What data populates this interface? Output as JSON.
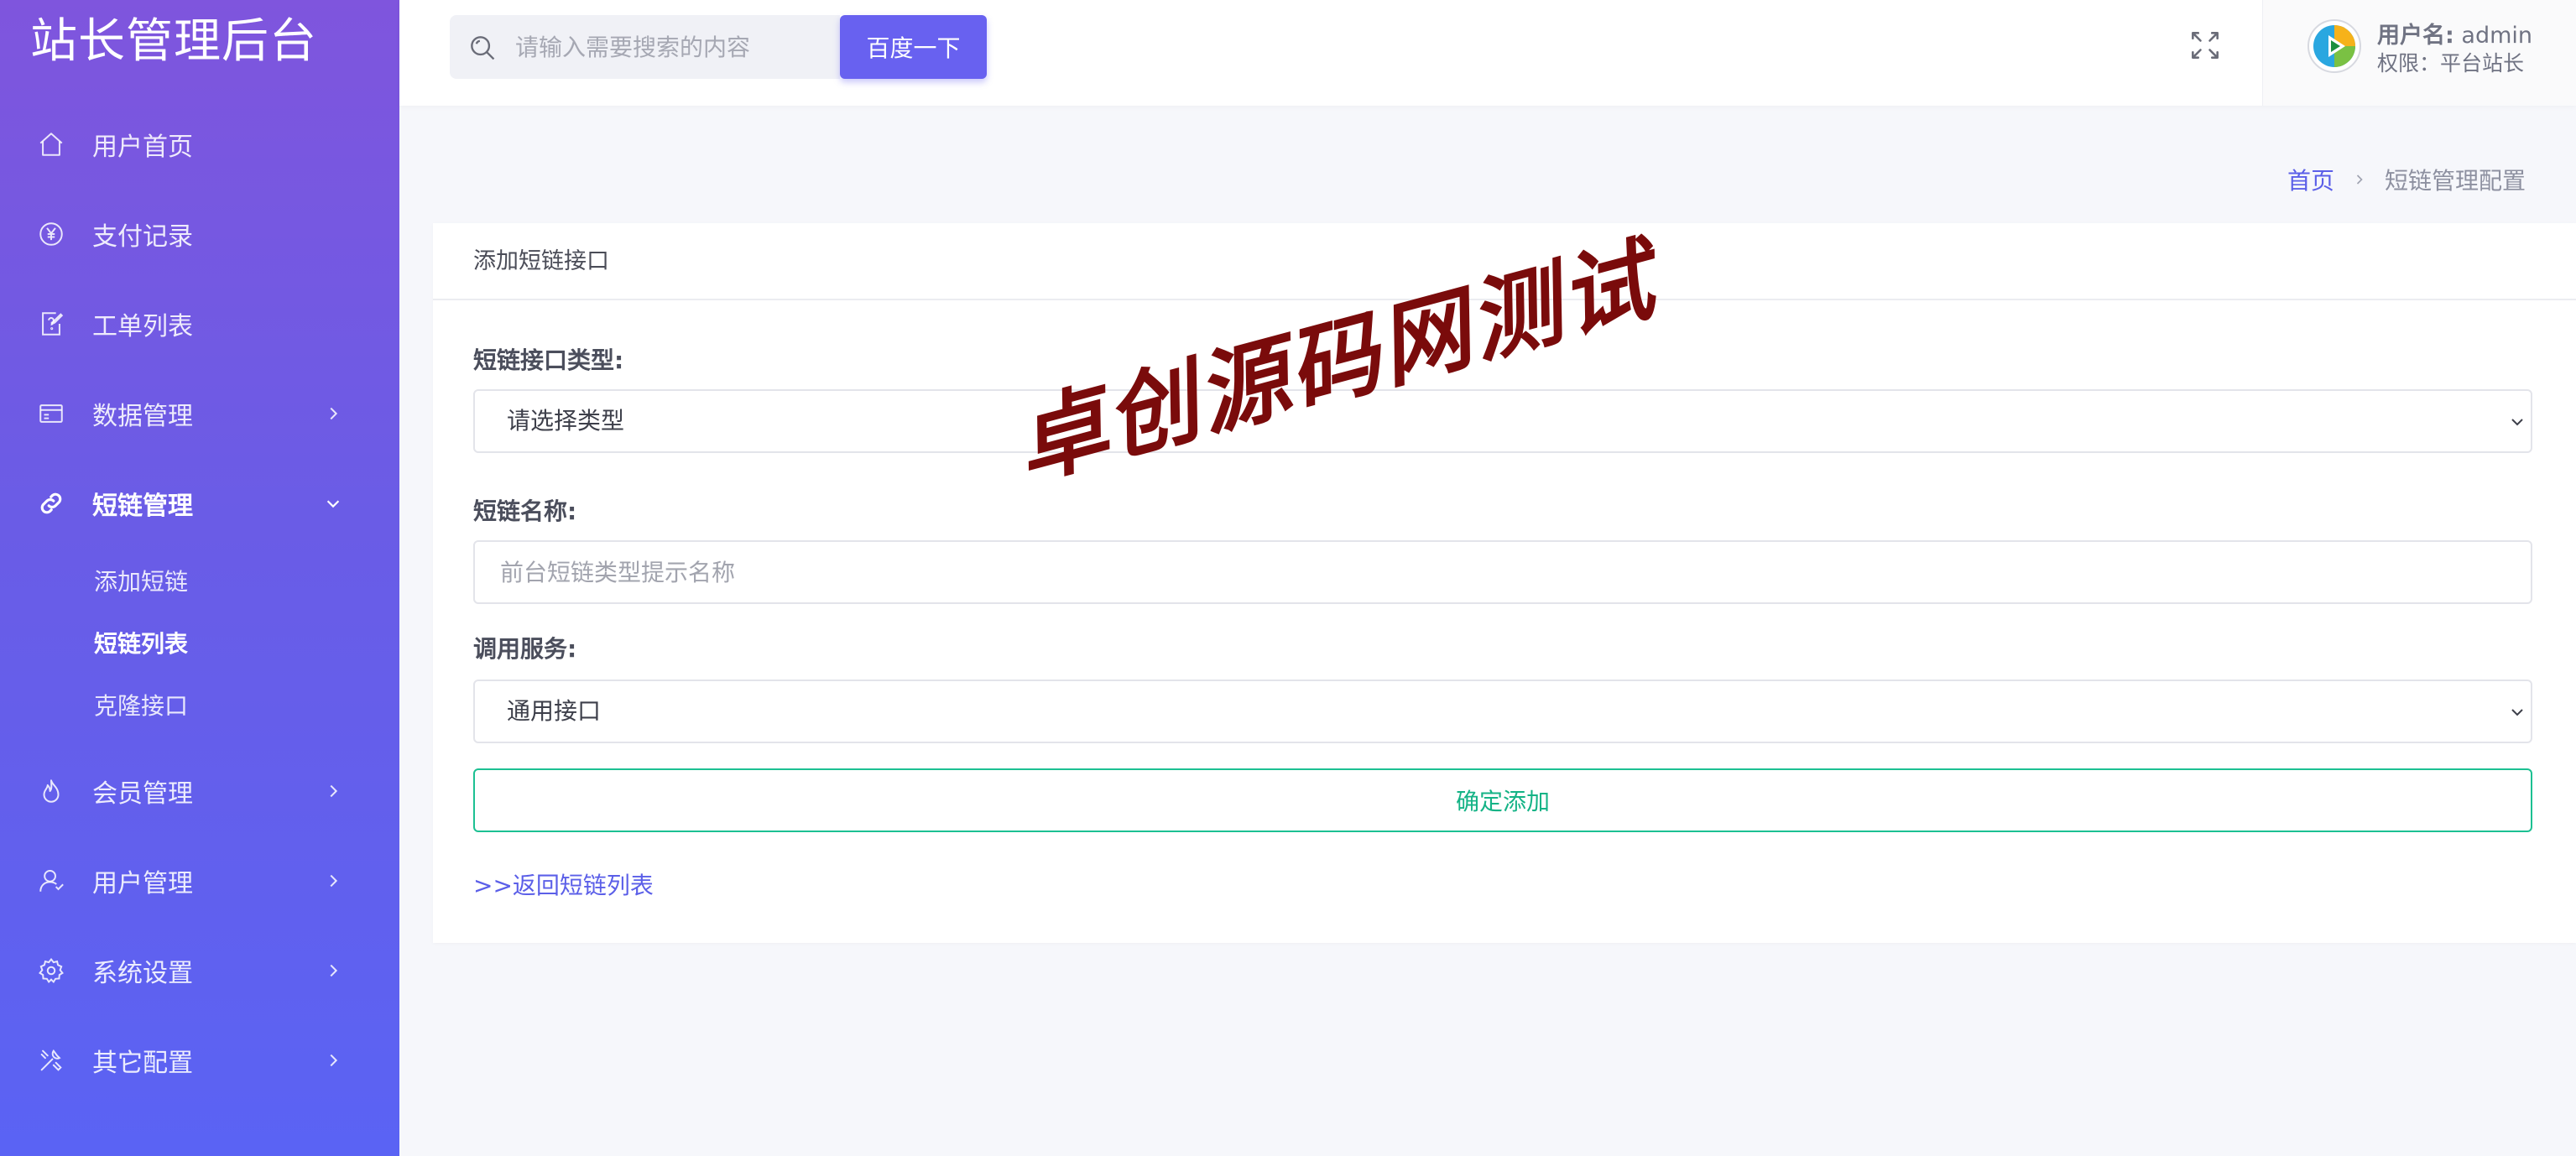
{
  "app": {
    "title": "站长管理后台"
  },
  "header": {
    "search_placeholder": "请输入需要搜索的内容",
    "search_button": "百度一下",
    "user_label": "用户名:",
    "user_name": "admin",
    "role_text": "权限：平台站长"
  },
  "sidebar": {
    "items": [
      {
        "label": "用户首页",
        "icon": "home-icon"
      },
      {
        "label": "支付记录",
        "icon": "yen-icon"
      },
      {
        "label": "工单列表",
        "icon": "ticket-icon"
      },
      {
        "label": "数据管理",
        "icon": "database-icon"
      },
      {
        "label": "短链管理",
        "icon": "link-icon"
      },
      {
        "label": "会员管理",
        "icon": "flame-icon"
      },
      {
        "label": "用户管理",
        "icon": "user-icon"
      },
      {
        "label": "系统设置",
        "icon": "gear-icon"
      },
      {
        "label": "其它配置",
        "icon": "tools-icon"
      }
    ],
    "sub_items": [
      {
        "label": "添加短链"
      },
      {
        "label": "短链列表"
      },
      {
        "label": "克隆接口"
      }
    ]
  },
  "breadcrumb": {
    "home": "首页",
    "current": "短链管理配置"
  },
  "card": {
    "title": "添加短链接口",
    "type_label": "短链接口类型:",
    "type_value": "请选择类型",
    "name_label": "短链名称:",
    "name_placeholder": "前台短链类型提示名称",
    "service_label": "调用服务:",
    "service_value": "通用接口",
    "submit": "确定添加",
    "back_link": ">>返回短链列表"
  },
  "watermark": "卓创源码网测试",
  "colors": {
    "accent": "#6861f0",
    "sidebar_top": "#7f55dd",
    "sidebar_bottom": "#5a63f4",
    "success": "#1cc092",
    "watermark": "#7a0b0b"
  }
}
